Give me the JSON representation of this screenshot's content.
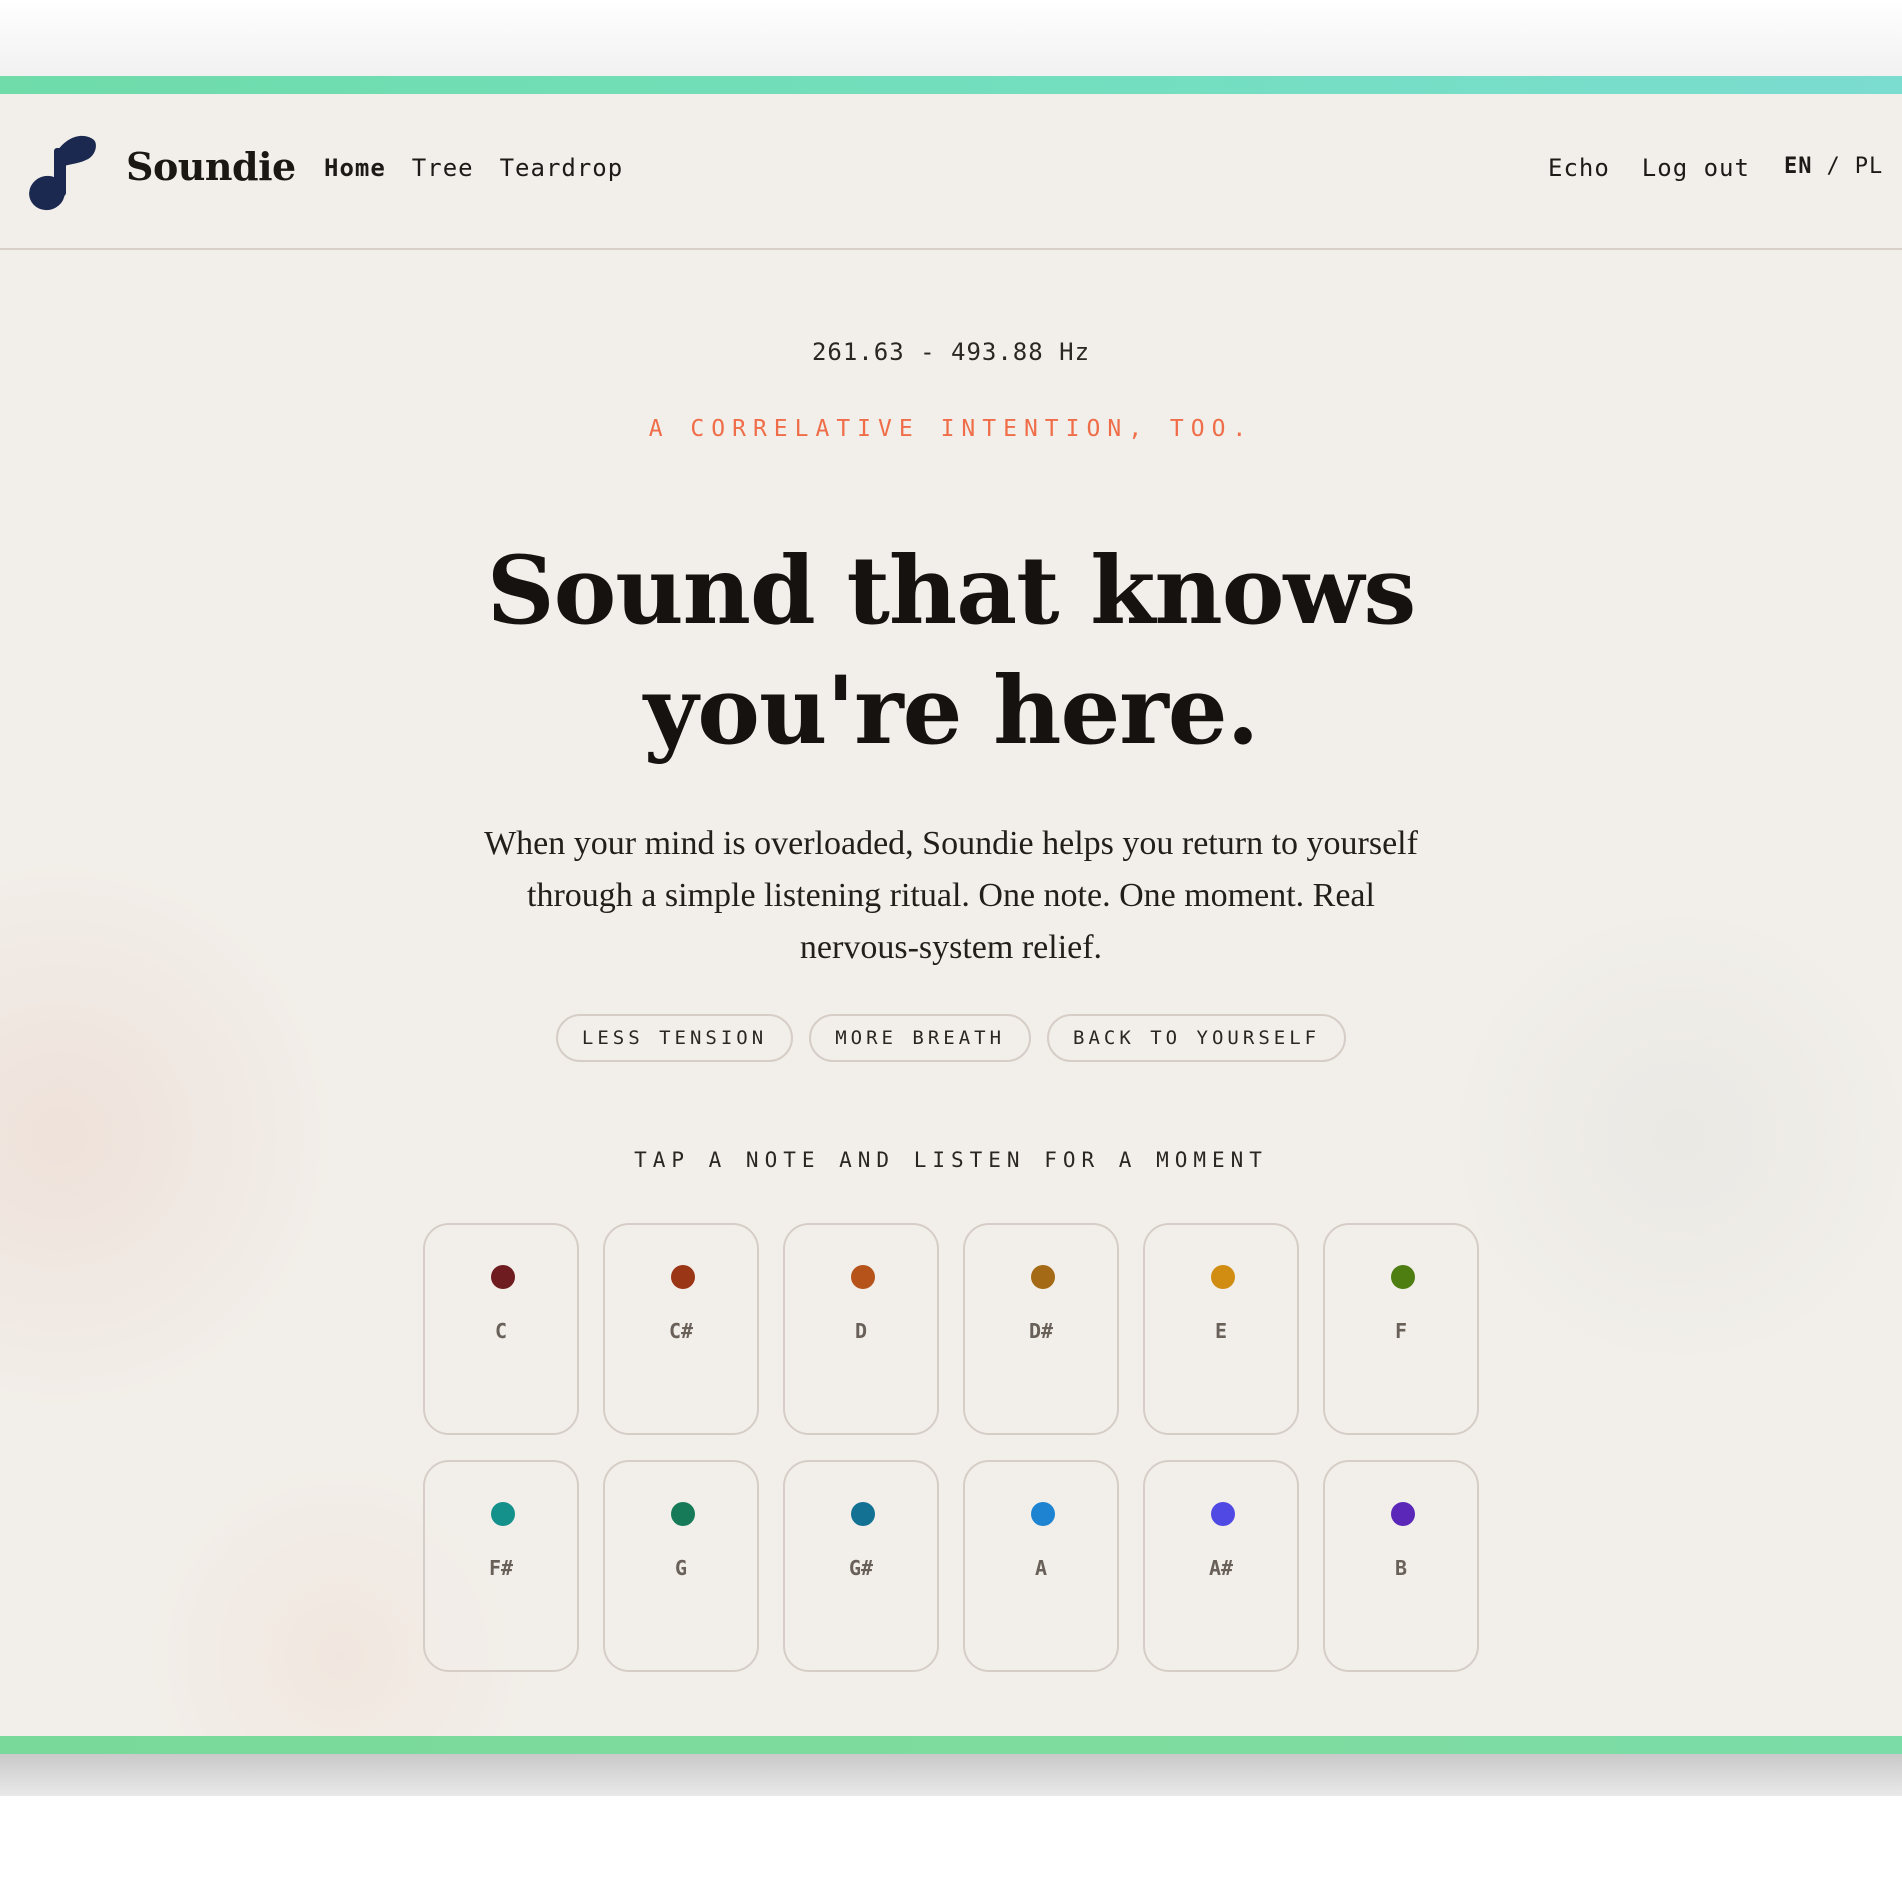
{
  "brand": {
    "name": "Soundie",
    "logo_icon": "music-note-icon",
    "logo_color": "#1b2850"
  },
  "nav": {
    "items": [
      {
        "label": "Home",
        "active": true
      },
      {
        "label": "Tree",
        "active": false
      },
      {
        "label": "Teardrop",
        "active": false
      }
    ],
    "right": [
      {
        "label": "Echo"
      },
      {
        "label": "Log out"
      }
    ],
    "lang": {
      "en": "EN",
      "separator": "/",
      "pl": "PL",
      "selected": "EN"
    }
  },
  "hero": {
    "frequency_range": "261.63 - 493.88 Hz",
    "eyebrow": "A CORRELATIVE INTENTION, TOO.",
    "headline_line1": "Sound that knows",
    "headline_line2": "you're here.",
    "lead_line1": "When your mind is overloaded, Soundie helps you return to yourself",
    "lead_line2": "through a simple listening ritual. One note. One moment. Real",
    "lead_line3": "nervous-system relief.",
    "chips": [
      "LESS TENSION",
      "MORE BREATH",
      "BACK TO YOURSELF"
    ],
    "tap_label": "TAP A NOTE AND LISTEN FOR A MOMENT"
  },
  "notes": [
    {
      "name": "C",
      "color": "#6e1c20"
    },
    {
      "name": "C#",
      "color": "#9a3516"
    },
    {
      "name": "D",
      "color": "#b5531a"
    },
    {
      "name": "D#",
      "color": "#a46a16"
    },
    {
      "name": "E",
      "color": "#d18d12"
    },
    {
      "name": "F",
      "color": "#4e7d12"
    },
    {
      "name": "F#",
      "color": "#13918a"
    },
    {
      "name": "G",
      "color": "#167a58"
    },
    {
      "name": "G#",
      "color": "#137293"
    },
    {
      "name": "A",
      "color": "#1e84d1"
    },
    {
      "name": "A#",
      "color": "#5149e4"
    },
    {
      "name": "B",
      "color": "#5a27b8"
    }
  ],
  "colors": {
    "accent": "#ef6e49",
    "background": "#f2efea",
    "top_bar": "#74dfc0",
    "bottom_bar": "#7fdc9f"
  }
}
